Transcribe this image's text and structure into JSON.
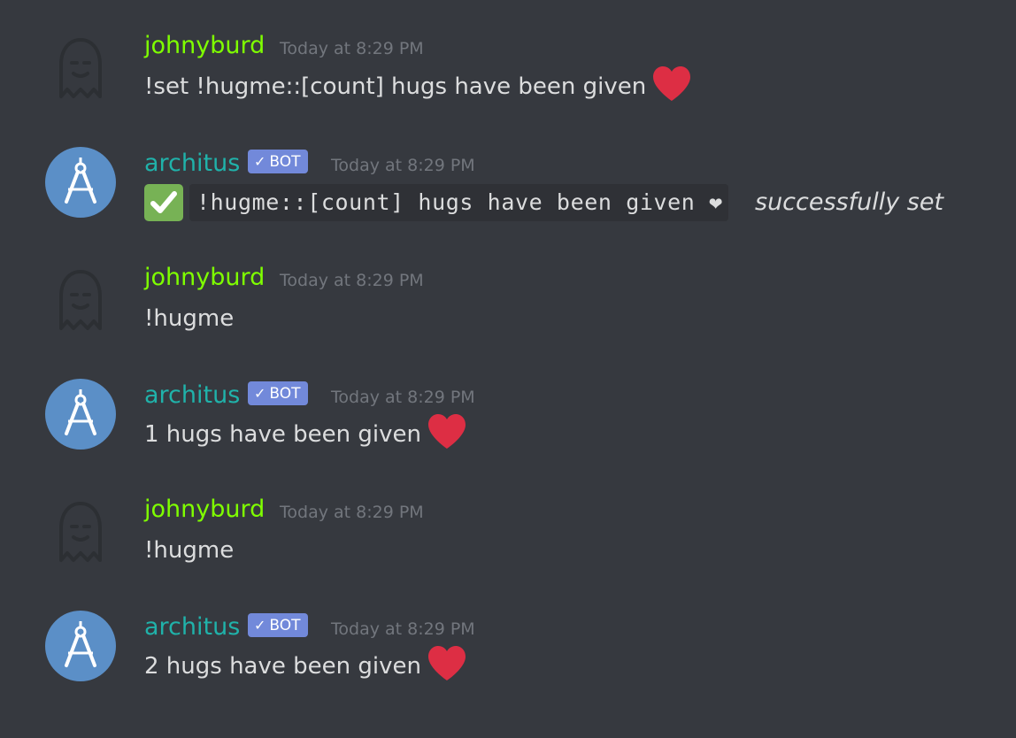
{
  "messages": [
    {
      "author": "johnyburd",
      "is_bot": false,
      "timestamp": "Today at 8:29 PM",
      "text": "!set !hugme::[count] hugs have been given",
      "emoji": "heart"
    },
    {
      "author": "architus",
      "is_bot": true,
      "bot_tag": "BOT",
      "timestamp": "Today at 8:29 PM",
      "code": "!hugme::[count] hugs have been given ❤",
      "suffix": "successfully set",
      "emoji": "white-check-mark"
    },
    {
      "author": "johnyburd",
      "is_bot": false,
      "timestamp": "Today at 8:29 PM",
      "text": "!hugme"
    },
    {
      "author": "architus",
      "is_bot": true,
      "bot_tag": "BOT",
      "timestamp": "Today at 8:29 PM",
      "text": "1 hugs have been given",
      "emoji": "heart"
    },
    {
      "author": "johnyburd",
      "is_bot": false,
      "timestamp": "Today at 8:29 PM",
      "text": "!hugme"
    },
    {
      "author": "architus",
      "is_bot": true,
      "bot_tag": "BOT",
      "timestamp": "Today at 8:29 PM",
      "text": "2 hugs have been given",
      "emoji": "heart"
    }
  ],
  "colors": {
    "background": "#36393f",
    "user_name": "#7fff00",
    "bot_name": "#20b2aa",
    "bot_tag": "#7289da",
    "timestamp": "#72767d",
    "text": "#dcddde",
    "heart": "#dd2e44",
    "check_box": "#77b255",
    "bot_avatar": "#5b8fc7"
  }
}
